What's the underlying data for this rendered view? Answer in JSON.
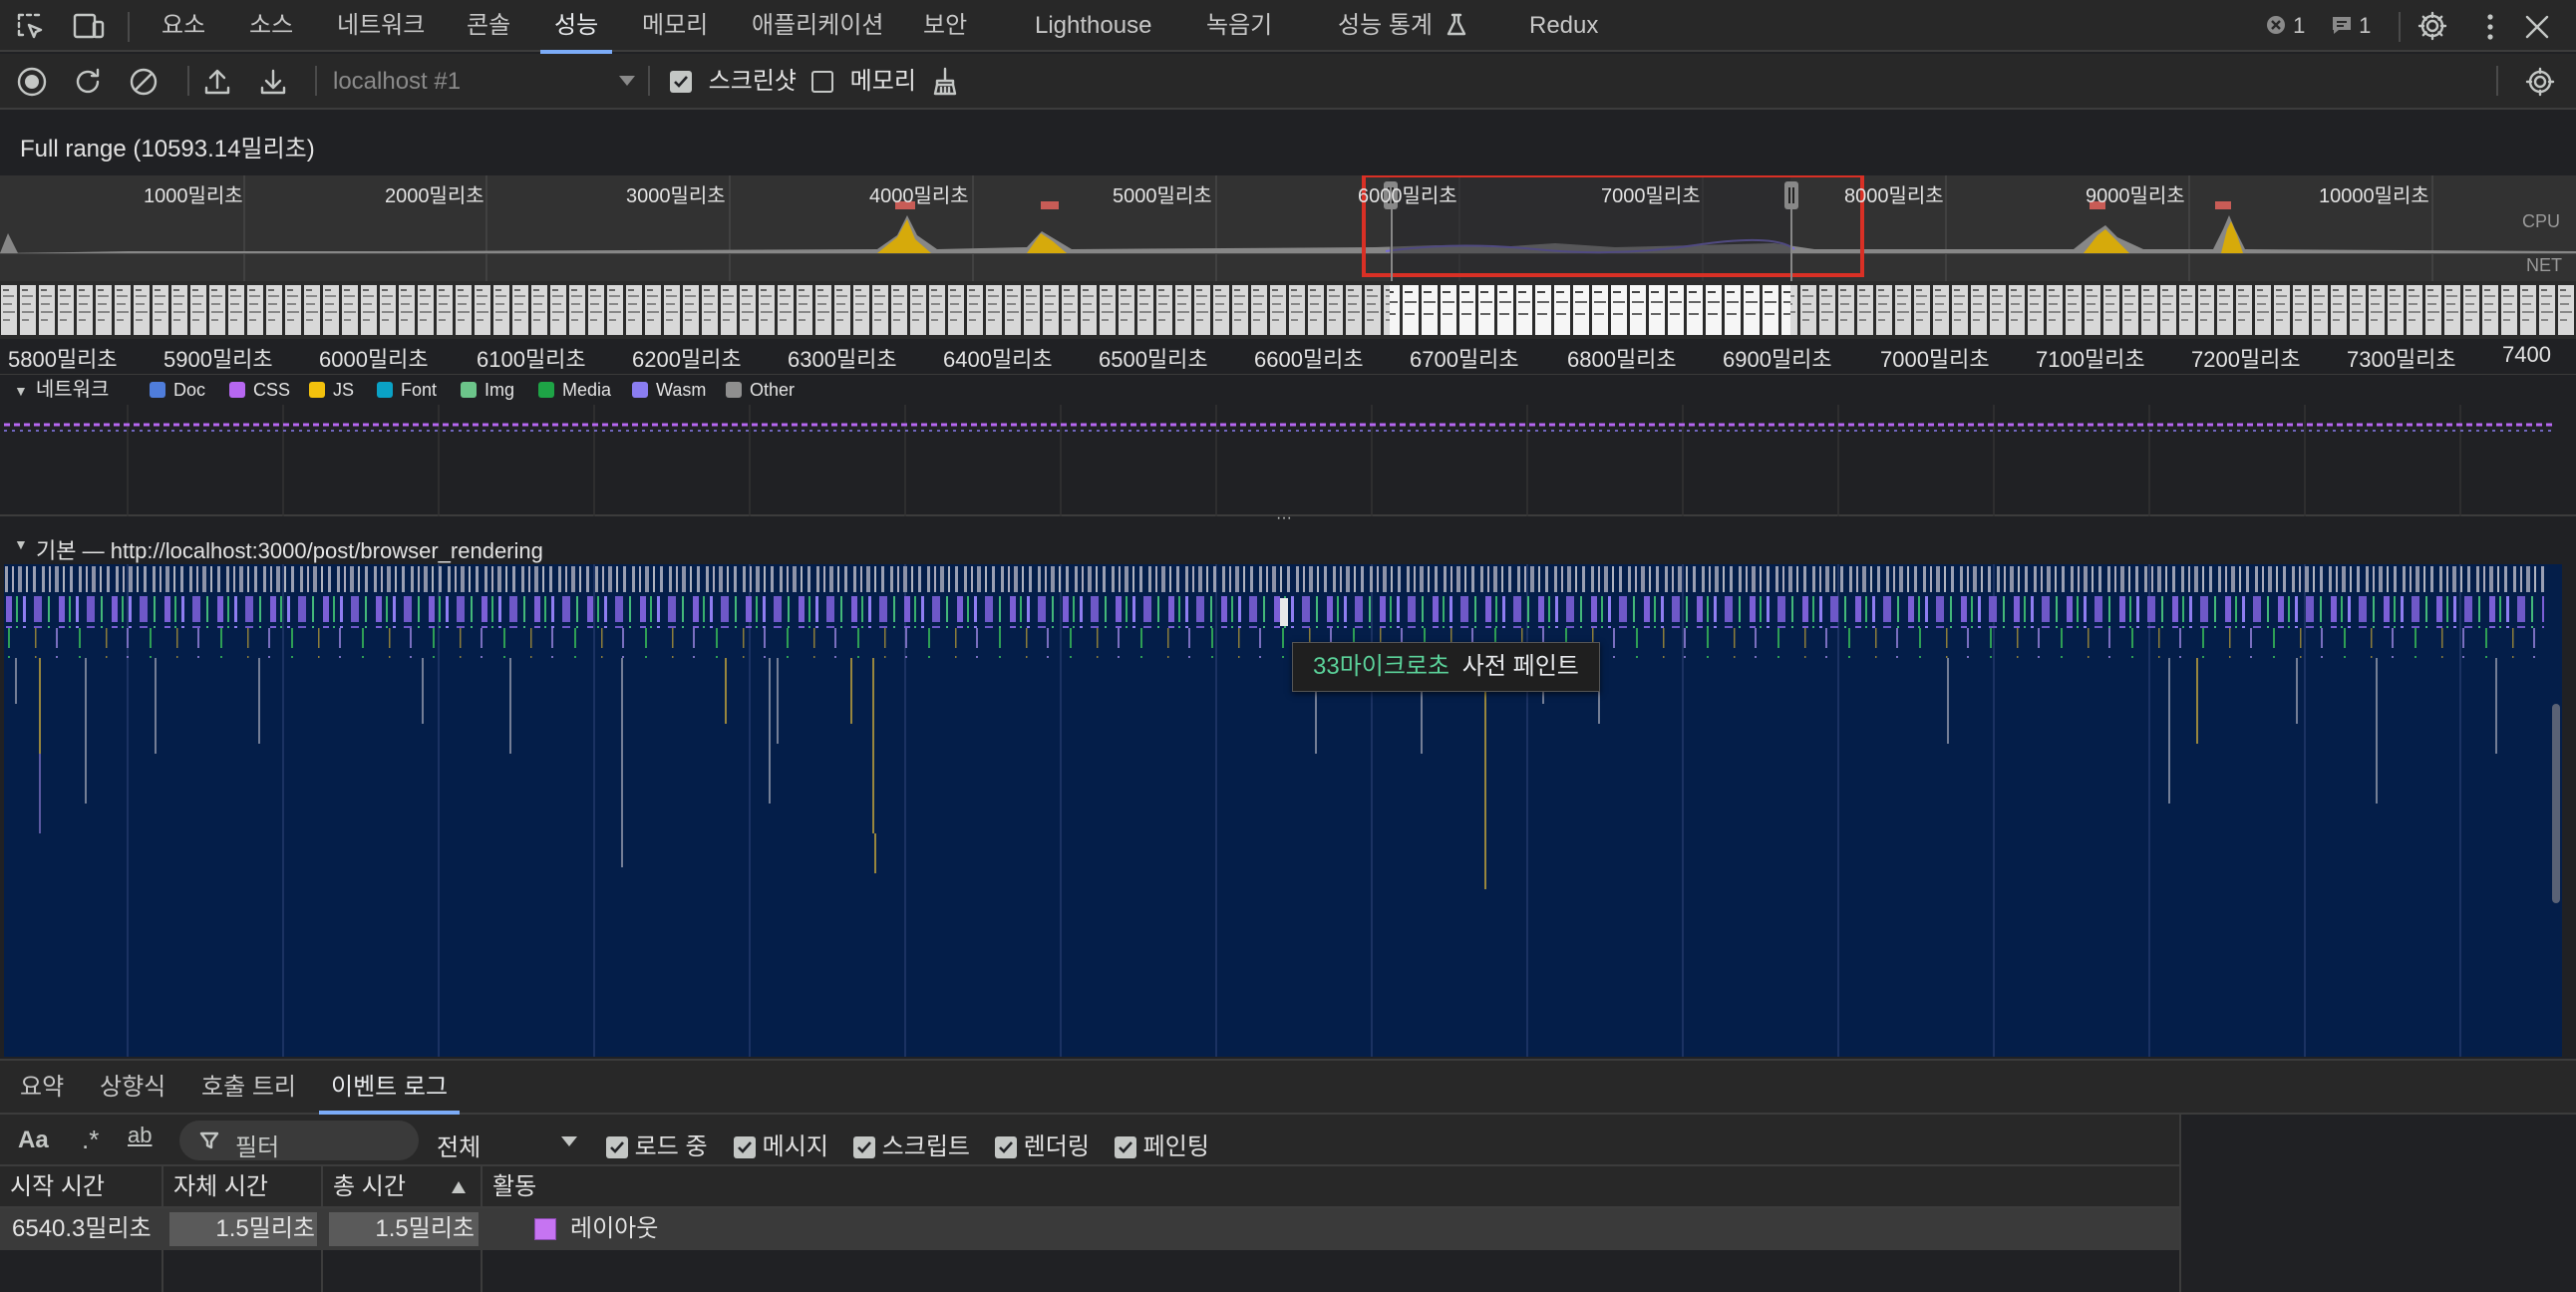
{
  "tabs": [
    {
      "label": "요소"
    },
    {
      "label": "소스"
    },
    {
      "label": "네트워크"
    },
    {
      "label": "콘솔"
    },
    {
      "label": "성능"
    },
    {
      "label": "메모리"
    },
    {
      "label": "애플리케이션"
    },
    {
      "label": "보안"
    },
    {
      "label": "Lighthouse"
    },
    {
      "label": "녹음기"
    },
    {
      "label": "성능 통계"
    },
    {
      "label": "Redux"
    }
  ],
  "active_tab": "성능",
  "error_count": "1",
  "message_count": "1",
  "toolbar": {
    "target": "localhost #1",
    "screenshot_label": "스크린샷",
    "screenshot_checked": true,
    "memory_label": "메모리",
    "memory_checked": false
  },
  "full_range": "Full range (10593.14밀리초)",
  "overview": {
    "ticks": [
      "1000밀리초",
      "2000밀리초",
      "3000밀리초",
      "4000밀리초",
      "5000밀리초",
      "6000밀리초",
      "7000밀리초",
      "8000밀리초",
      "9000밀리초",
      "10000밀리초"
    ],
    "cpu_label": "CPU",
    "net_label": "NET"
  },
  "timeline_ticks": [
    "5800밀리초",
    "5900밀리초",
    "6000밀리초",
    "6100밀리초",
    "6200밀리초",
    "6300밀리초",
    "6400밀리초",
    "6500밀리초",
    "6600밀리초",
    "6700밀리초",
    "6800밀리초",
    "6900밀리초",
    "7000밀리초",
    "7100밀리초",
    "7200밀리초",
    "7300밀리초",
    "7400"
  ],
  "network": {
    "title": "네트워크",
    "legend": [
      {
        "label": "Doc",
        "color": "#4f7ddb"
      },
      {
        "label": "CSS",
        "color": "#b667f1"
      },
      {
        "label": "JS",
        "color": "#f4c20d"
      },
      {
        "label": "Font",
        "color": "#0aa2c6"
      },
      {
        "label": "Img",
        "color": "#6cc58a"
      },
      {
        "label": "Media",
        "color": "#1ea446"
      },
      {
        "label": "Wasm",
        "color": "#8a7df1"
      },
      {
        "label": "Other",
        "color": "#8f8f8f"
      }
    ]
  },
  "main_track": "기본 — http://localhost:3000/post/browser_rendering",
  "tooltip": {
    "time": "33마이크로초",
    "label": "사전 페인트"
  },
  "bottom_tabs": [
    {
      "label": "요약"
    },
    {
      "label": "상향식"
    },
    {
      "label": "호출 트리"
    },
    {
      "label": "이벤트 로그"
    }
  ],
  "active_bottom_tab": "이벤트 로그",
  "filter": {
    "placeholder": "필터",
    "select_value": "전체",
    "checks": [
      {
        "label": "로드 중",
        "checked": true
      },
      {
        "label": "메시지",
        "checked": true
      },
      {
        "label": "스크립트",
        "checked": true
      },
      {
        "label": "렌더링",
        "checked": true
      },
      {
        "label": "페인팅",
        "checked": true
      }
    ]
  },
  "table": {
    "headers": [
      "시작 시간",
      "자체 시간",
      "총 시간",
      "활동"
    ],
    "row": {
      "start": "6540.3밀리초",
      "self": "1.5밀리초",
      "total": "1.5밀리초",
      "activity": "레이아웃",
      "activity_color": "#c674f2"
    }
  }
}
